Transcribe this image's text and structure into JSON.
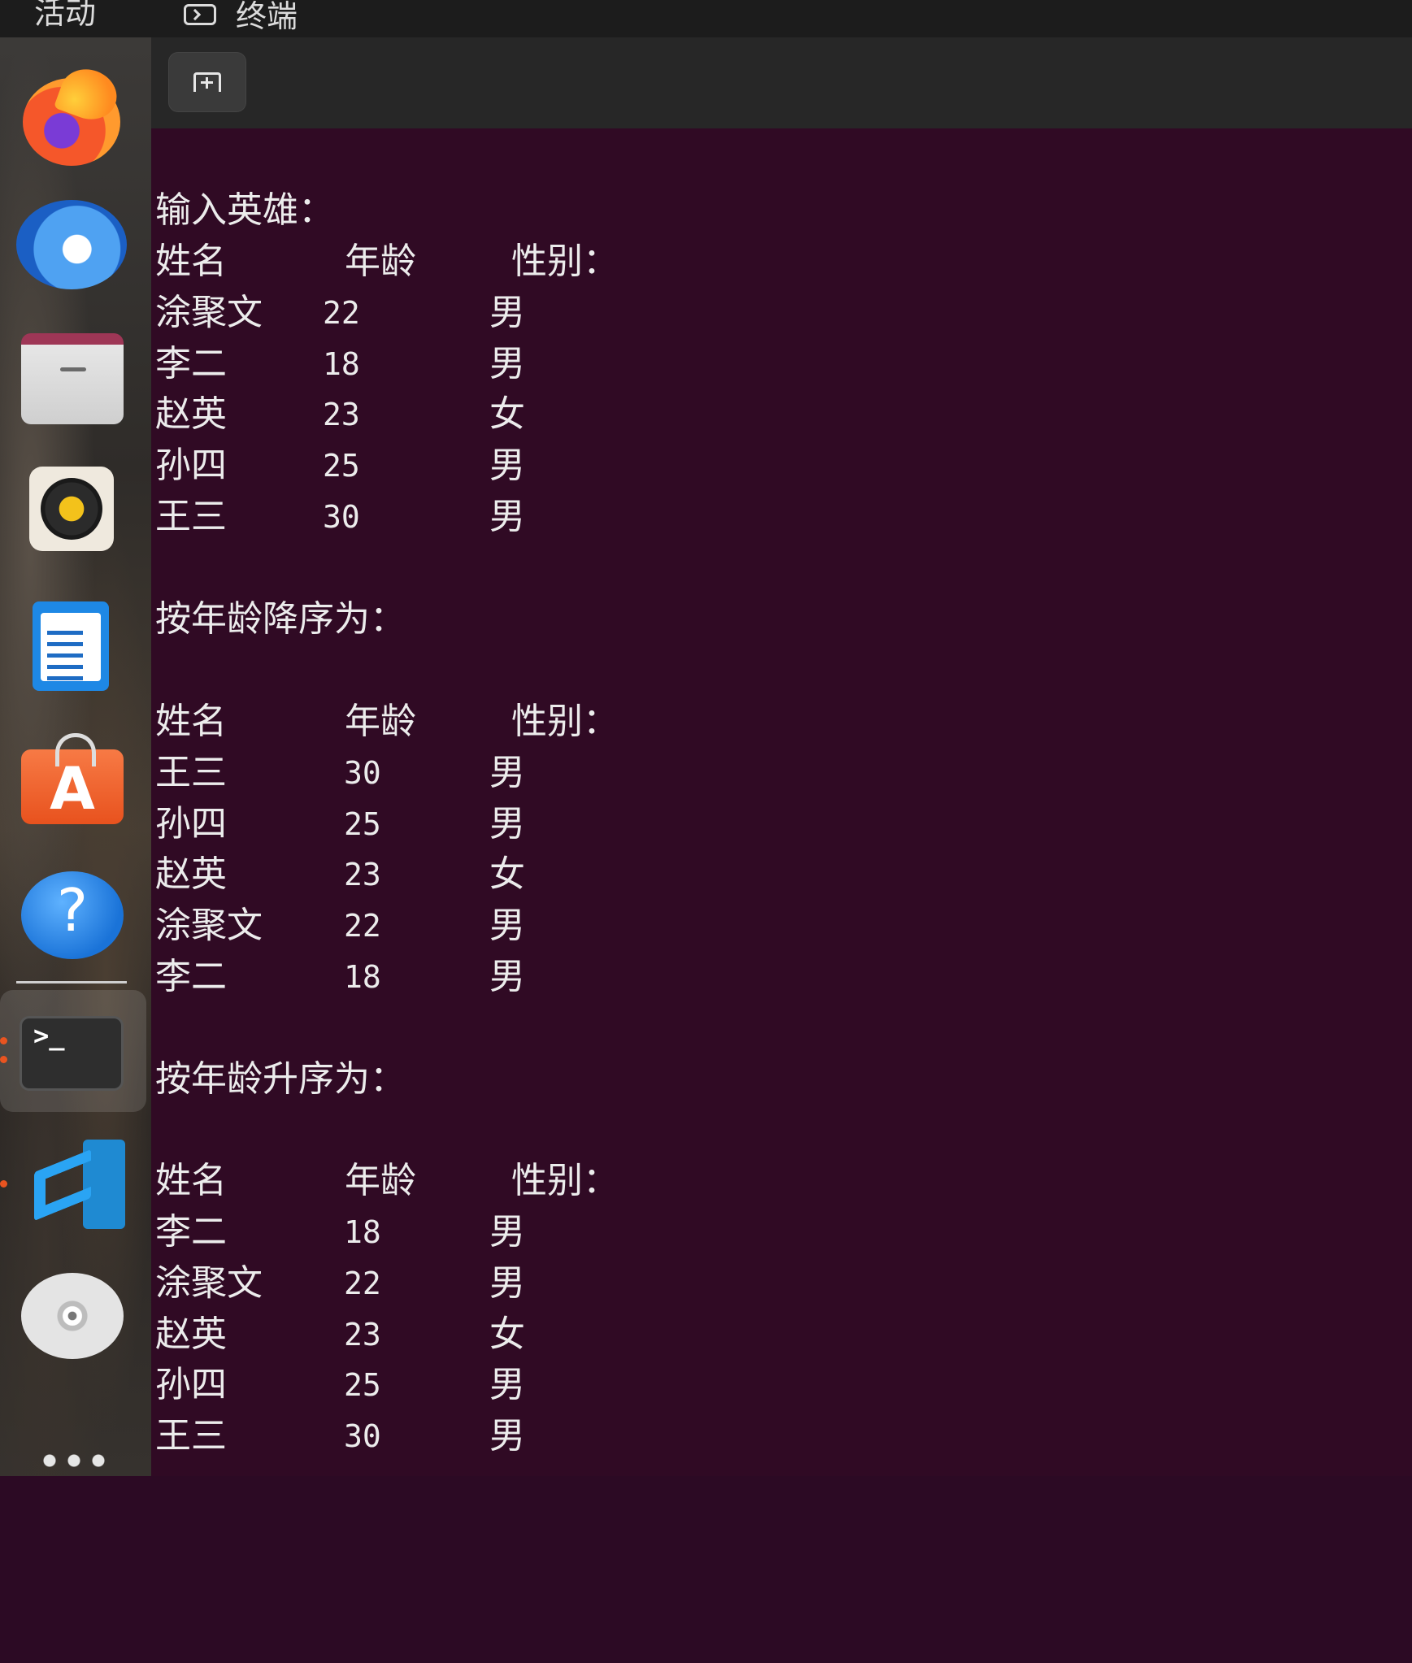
{
  "topbar": {
    "activities": "活动",
    "app_name": "终端"
  },
  "dock": {
    "items": [
      {
        "name": "firefox",
        "icon": "firefox-icon"
      },
      {
        "name": "thunderbird",
        "icon": "thunderbird-icon"
      },
      {
        "name": "files",
        "icon": "files-icon"
      },
      {
        "name": "rhythmbox",
        "icon": "rhythmbox-icon"
      },
      {
        "name": "writer",
        "icon": "writer-icon"
      },
      {
        "name": "app-center",
        "icon": "app-store-icon"
      },
      {
        "name": "help",
        "icon": "help-icon"
      },
      {
        "name": "terminal",
        "icon": "terminal-icon"
      },
      {
        "name": "vscode",
        "icon": "vscode-icon"
      },
      {
        "name": "dvd",
        "icon": "dvd-icon"
      },
      {
        "name": "show-apps",
        "icon": "app-grid-icon"
      }
    ],
    "accent": "#e95420"
  },
  "terminal": {
    "new_tab_icon": "new-tab-icon",
    "background": "#300a24",
    "input_heading": "输入英雄：",
    "header": {
      "name": "姓名",
      "age": "年龄",
      "gender": "性别："
    },
    "input_rows": [
      {
        "name": "涂聚文",
        "age": "22",
        "gender": "男"
      },
      {
        "name": "李二",
        "age": "18",
        "gender": "男"
      },
      {
        "name": "赵英",
        "age": "23",
        "gender": "女"
      },
      {
        "name": "孙四",
        "age": "25",
        "gender": "男"
      },
      {
        "name": "王三",
        "age": "30",
        "gender": "男"
      }
    ],
    "desc_heading": "按年龄降序为：",
    "desc_rows": [
      {
        "name": "王三",
        "age": "30",
        "gender": "男"
      },
      {
        "name": "孙四",
        "age": "25",
        "gender": "男"
      },
      {
        "name": "赵英",
        "age": "23",
        "gender": "女"
      },
      {
        "name": "涂聚文",
        "age": "22",
        "gender": "男"
      },
      {
        "name": "李二",
        "age": "18",
        "gender": "男"
      }
    ],
    "asc_heading": "按年龄升序为：",
    "asc_rows": [
      {
        "name": "李二",
        "age": "18",
        "gender": "男"
      },
      {
        "name": "涂聚文",
        "age": "22",
        "gender": "男"
      },
      {
        "name": "赵英",
        "age": "23",
        "gender": "女"
      },
      {
        "name": "孙四",
        "age": "25",
        "gender": "男"
      },
      {
        "name": "王三",
        "age": "30",
        "gender": "男"
      }
    ]
  }
}
